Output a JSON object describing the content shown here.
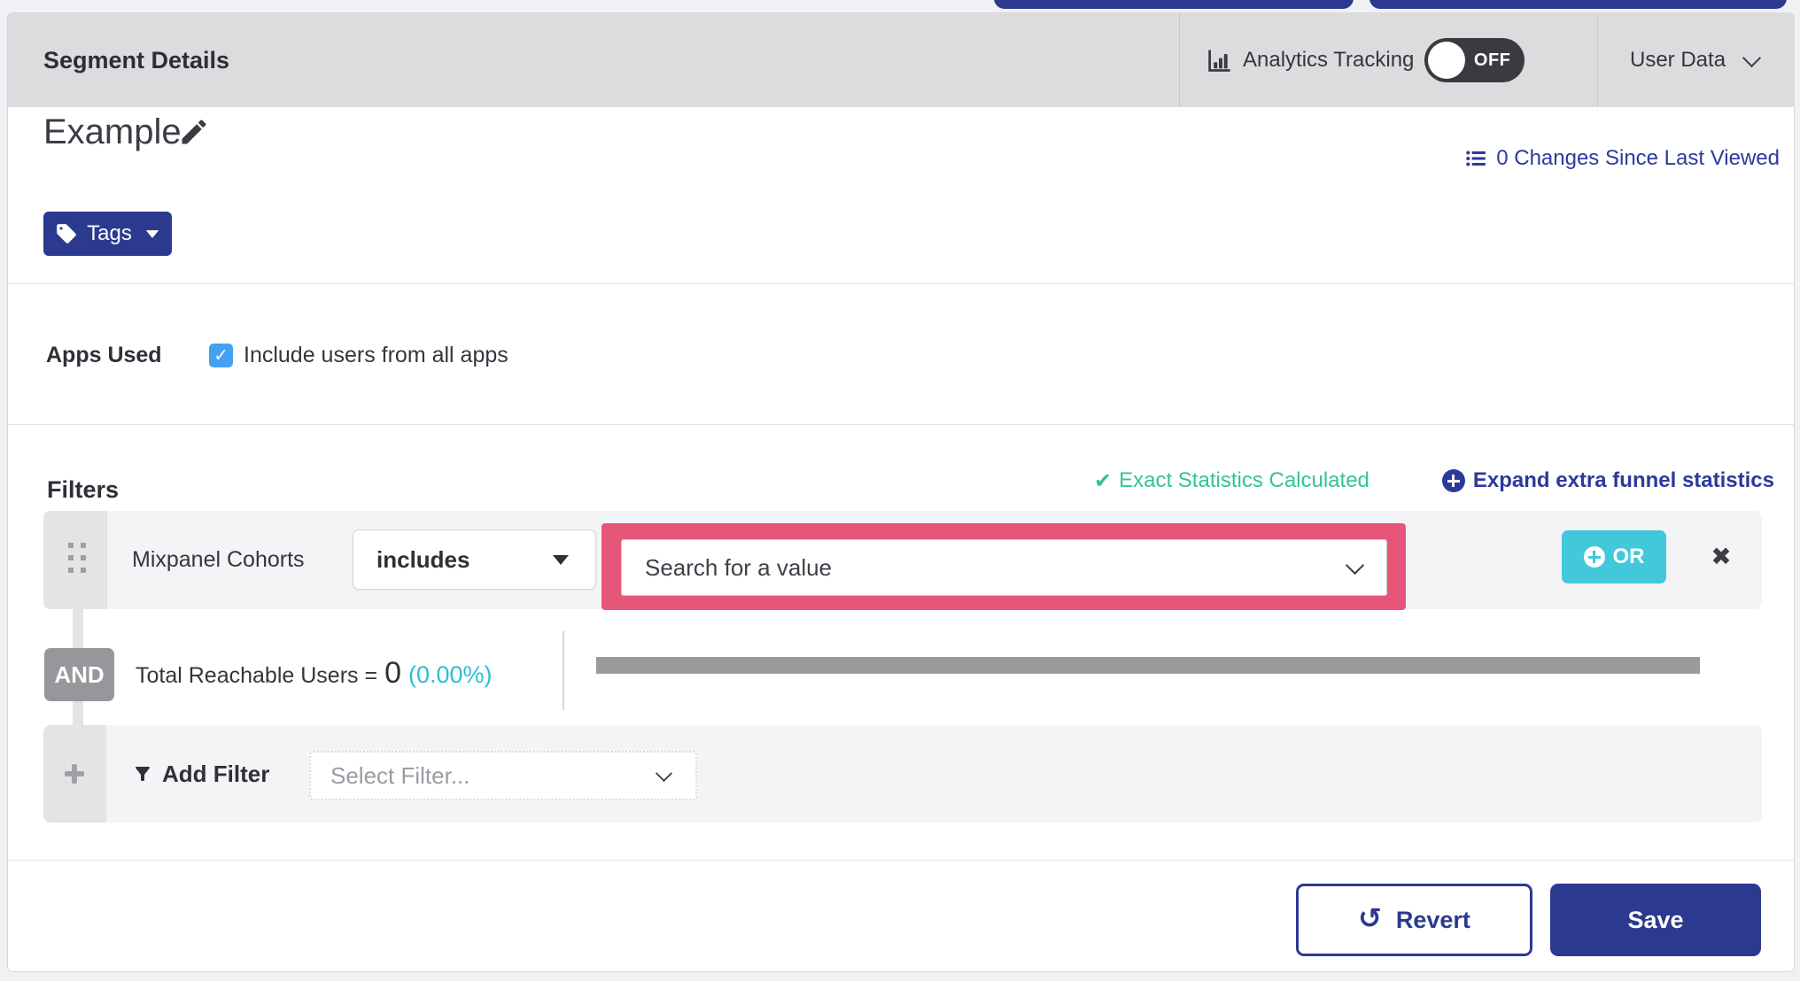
{
  "header": {
    "title": "Segment Details",
    "analytics_label": "Analytics Tracking",
    "toggle_state": "OFF",
    "user_data_label": "User Data"
  },
  "segment": {
    "name": "Example",
    "changes_link": "0 Changes Since Last Viewed",
    "tags_label": "Tags"
  },
  "apps": {
    "label": "Apps Used",
    "checkbox_label": "Include users from all apps",
    "checkbox_checked": true,
    "checkmark": "✓"
  },
  "filters": {
    "heading": "Filters",
    "exact_statistics": "Exact Statistics Calculated",
    "exact_check": "✔",
    "expand_funnel": "Expand extra funnel statistics",
    "row": {
      "attribute": "Mixpanel Cohorts",
      "operator": "includes",
      "value_placeholder": "Search for a value",
      "or_label": "OR",
      "close": "✖"
    },
    "conjunction": "AND",
    "reachable": {
      "label": "Total Reachable Users =",
      "value": "0",
      "percent": "(0.00%)",
      "progress_percent": 0
    },
    "add": {
      "label": "Add Filter",
      "placeholder": "Select Filter..."
    }
  },
  "footer": {
    "revert_label": "Revert",
    "revert_icon": "↺",
    "save_label": "Save"
  },
  "colors": {
    "indigo": "#2b3a8f",
    "teal_green": "#31c39c",
    "cyan_pct": "#2abfd3",
    "or_button": "#41c8da",
    "pink_highlight": "#e65679",
    "header_gray": "#dcdcdf",
    "row_gray": "#f4f4f6",
    "strip_gray": "#e4e4e7",
    "and_badge_gray": "#97979b",
    "checkbox_blue": "#42a1f4",
    "progress_gray": "#9b9b9e"
  }
}
